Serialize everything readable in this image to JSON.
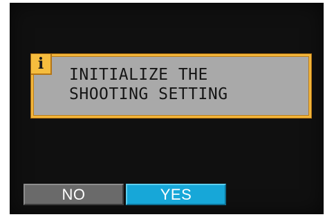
{
  "dialog": {
    "icon": "info-icon",
    "icon_glyph": "i",
    "message_line1": "INITIALIZE THE",
    "message_line2": "SHOOTING SETTING",
    "border_color": "#f2b53a"
  },
  "buttons": {
    "no_label": "NO",
    "yes_label": "YES",
    "selected": "YES",
    "selected_color": "#17a7d8"
  }
}
